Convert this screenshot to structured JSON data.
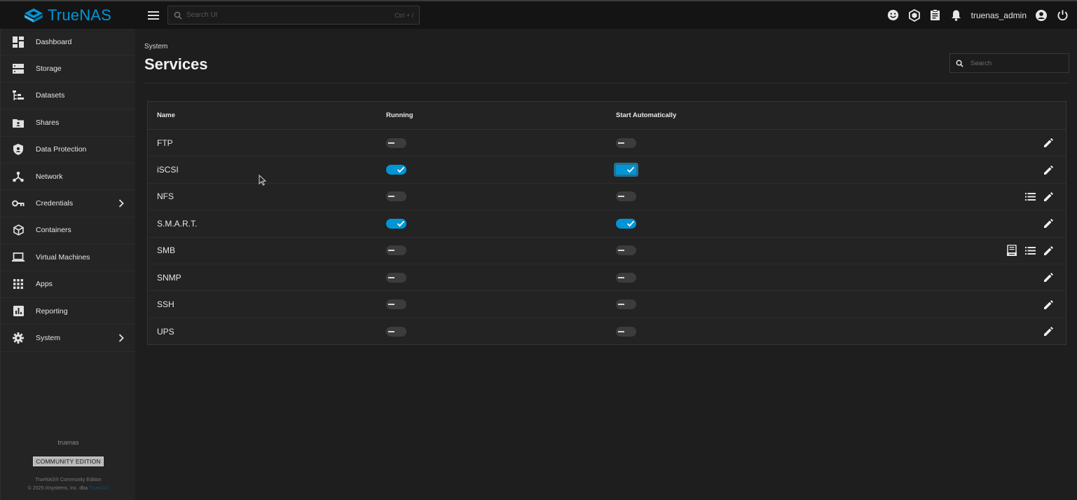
{
  "app": {
    "logo_text": "TrueNAS",
    "brand_color": "#0095d5"
  },
  "topbar": {
    "search_placeholder": "Search UI",
    "search_shortcut": "Ctrl + /",
    "username": "truenas_admin",
    "icons": [
      "feedback-icon",
      "truecommand-icon",
      "jobs-icon",
      "notifications-icon",
      "account-circle-icon",
      "power-icon"
    ]
  },
  "sidebar": {
    "items": [
      {
        "label": "Dashboard",
        "icon": "dashboard-icon"
      },
      {
        "label": "Storage",
        "icon": "storage-icon"
      },
      {
        "label": "Datasets",
        "icon": "datasets-icon"
      },
      {
        "label": "Shares",
        "icon": "shares-icon"
      },
      {
        "label": "Data Protection",
        "icon": "shield-icon"
      },
      {
        "label": "Network",
        "icon": "network-icon"
      },
      {
        "label": "Credentials",
        "icon": "key-icon",
        "expandable": true
      },
      {
        "label": "Containers",
        "icon": "cube-icon"
      },
      {
        "label": "Virtual Machines",
        "icon": "laptop-icon"
      },
      {
        "label": "Apps",
        "icon": "apps-grid-icon"
      },
      {
        "label": "Reporting",
        "icon": "bar-chart-icon"
      },
      {
        "label": "System",
        "icon": "gear-icon",
        "expandable": true
      }
    ],
    "footer": {
      "hostname": "truenas",
      "edition": "COMMUNITY EDITION",
      "product_line": "TrueNAS® Community Edition",
      "copyright_prefix": "© 2025 iXsystems, Inc. dba",
      "copyright_brand": "TrueNAS"
    }
  },
  "page": {
    "breadcrumb": "System",
    "title": "Services",
    "search_placeholder": "Search"
  },
  "table": {
    "columns": [
      "Name",
      "Running",
      "Start Automatically"
    ],
    "rows": [
      {
        "name": "FTP",
        "running": false,
        "auto": false,
        "actions": [
          "edit"
        ]
      },
      {
        "name": "iSCSI",
        "running": true,
        "auto": true,
        "auto_focused": true,
        "actions": [
          "edit"
        ]
      },
      {
        "name": "NFS",
        "running": false,
        "auto": false,
        "actions": [
          "list",
          "edit"
        ]
      },
      {
        "name": "S.M.A.R.T.",
        "running": true,
        "auto": true,
        "actions": [
          "edit"
        ]
      },
      {
        "name": "SMB",
        "running": false,
        "auto": false,
        "actions": [
          "audit",
          "list",
          "edit"
        ]
      },
      {
        "name": "SNMP",
        "running": false,
        "auto": false,
        "actions": [
          "edit"
        ]
      },
      {
        "name": "SSH",
        "running": false,
        "auto": false,
        "actions": [
          "edit"
        ]
      },
      {
        "name": "UPS",
        "running": false,
        "auto": false,
        "actions": [
          "edit"
        ]
      }
    ]
  }
}
